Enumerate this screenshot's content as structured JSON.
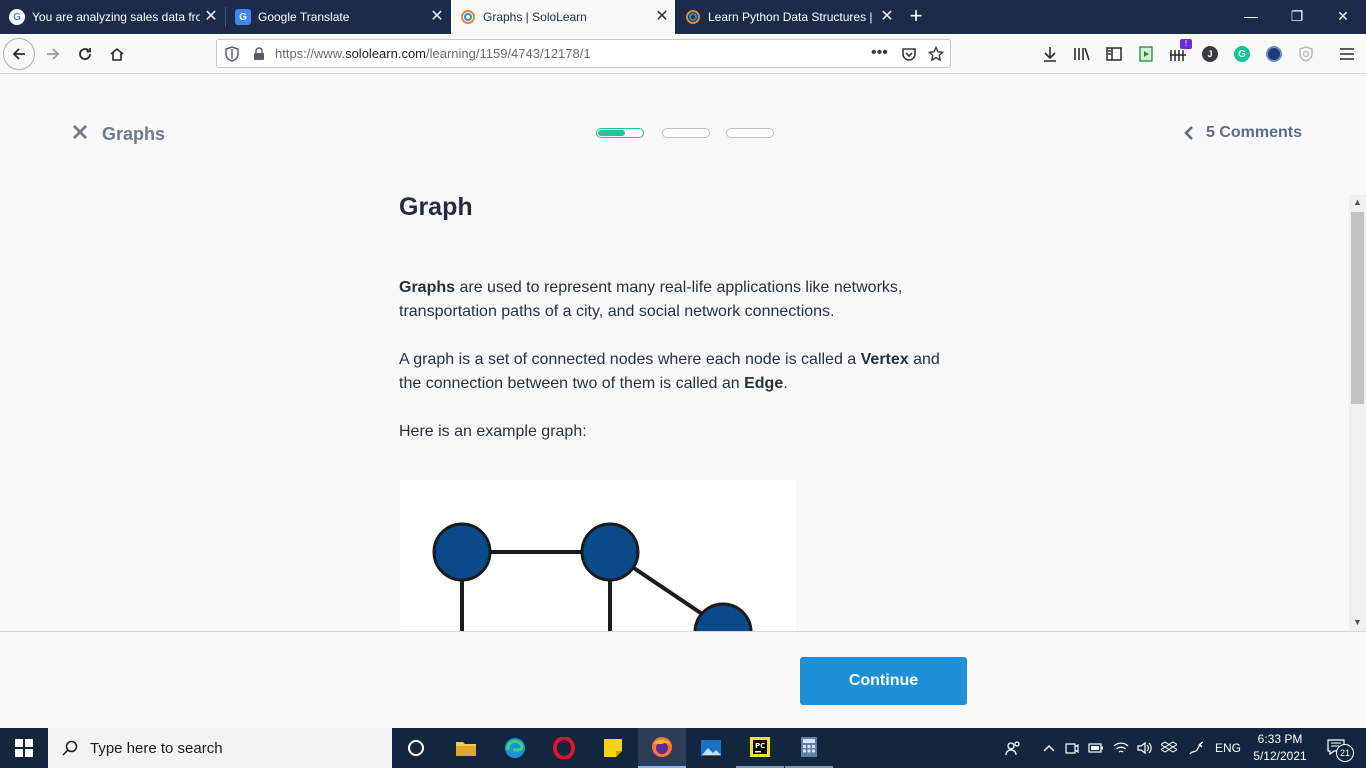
{
  "browser": {
    "tabs": [
      {
        "title": "You are analyzing sales data fro",
        "favicon": "google-icon",
        "active": false
      },
      {
        "title": "Google Translate",
        "favicon": "google-translate-icon",
        "active": false
      },
      {
        "title": "Graphs | SoloLearn",
        "favicon": "sololearn-icon",
        "active": true
      },
      {
        "title": "Learn Python Data Structures |",
        "favicon": "sololearn-icon",
        "active": false
      }
    ],
    "url_prefix": "https://www.",
    "url_domain": "sololearn.com",
    "url_path": "/learning/1159/4743/12178/1",
    "extension_badge": "!"
  },
  "lesson": {
    "title": "Graphs",
    "progress": [
      0.62,
      0,
      0
    ],
    "comments_label": "5 Comments"
  },
  "content": {
    "heading": "Graph",
    "p1_bold": "Graphs",
    "p1_rest": " are used to represent many real-life applications like networks, transportation paths of a city, and social network connections.",
    "p2_a": "A graph is a set of connected nodes where each node is called a ",
    "p2_vertex": "Vertex",
    "p2_b": " and the connection between two of them is called an ",
    "p2_edge": "Edge",
    "p2_c": ".",
    "p3": "Here is an example graph:",
    "node_color": "#0a4a8a"
  },
  "footer": {
    "continue_label": "Continue"
  },
  "taskbar": {
    "search_placeholder": "Type here to search",
    "language": "ENG",
    "time": "6:33 PM",
    "date": "5/12/2021",
    "notification_count": "21"
  },
  "colors": {
    "accent": "#1e90d8",
    "progress_fill": "#27c3a0",
    "tabstrip": "#1d2b4b",
    "taskbar": "#13263f"
  }
}
